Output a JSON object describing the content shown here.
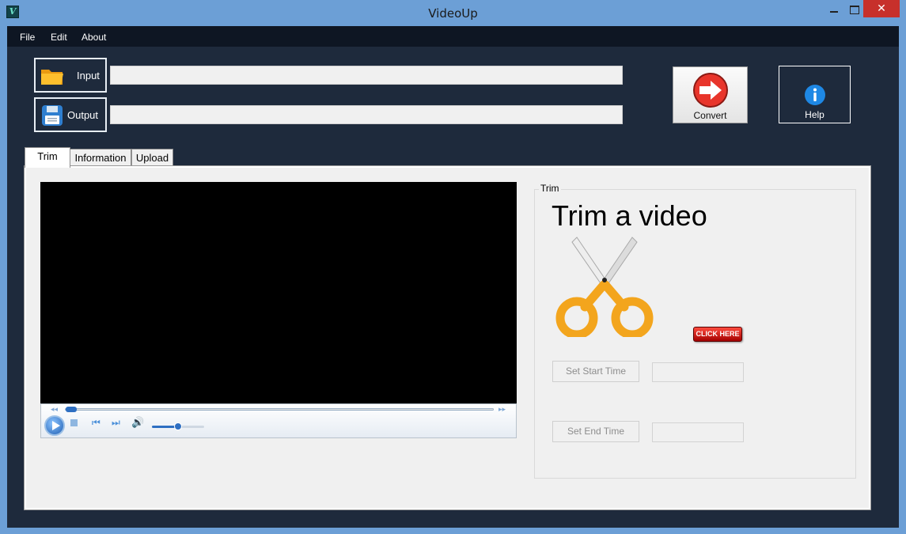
{
  "window": {
    "title": "VideoUp",
    "app_icon": "V",
    "close_glyph": "✕"
  },
  "menu": [
    "File",
    "Edit",
    "About"
  ],
  "toolbar": {
    "input_label": "Input",
    "output_label": "Output",
    "input_path": "",
    "output_path": "",
    "convert_label": "Convert",
    "help_label": "Help"
  },
  "tabs": [
    {
      "label": "Trim",
      "active": true
    },
    {
      "label": "Information",
      "active": false
    },
    {
      "label": "Upload",
      "active": false
    }
  ],
  "player": {
    "seek_position": 0.0,
    "volume": 0.5,
    "state": "stopped"
  },
  "trim": {
    "group_title": "Trim",
    "heading": "Trim a video",
    "click_here_label": "CLICK HERE",
    "set_start_label": "Set Start Time",
    "set_end_label": "Set End Time",
    "start_time": "",
    "end_time": ""
  },
  "colors": {
    "titlebar": "#6c9fd6",
    "client_bg": "#1e2a3c",
    "menubar_bg": "#0e1623",
    "close_button": "#c7302b",
    "convert_icon": "#e8352b",
    "help_icon": "#1e88e5",
    "scissors_handles": "#f3a51d"
  },
  "icons": {
    "input": "folder-icon",
    "output": "floppy-disk-icon",
    "convert": "arrow-right-circle-icon",
    "help": "info-icon",
    "trim": "scissors-icon"
  }
}
